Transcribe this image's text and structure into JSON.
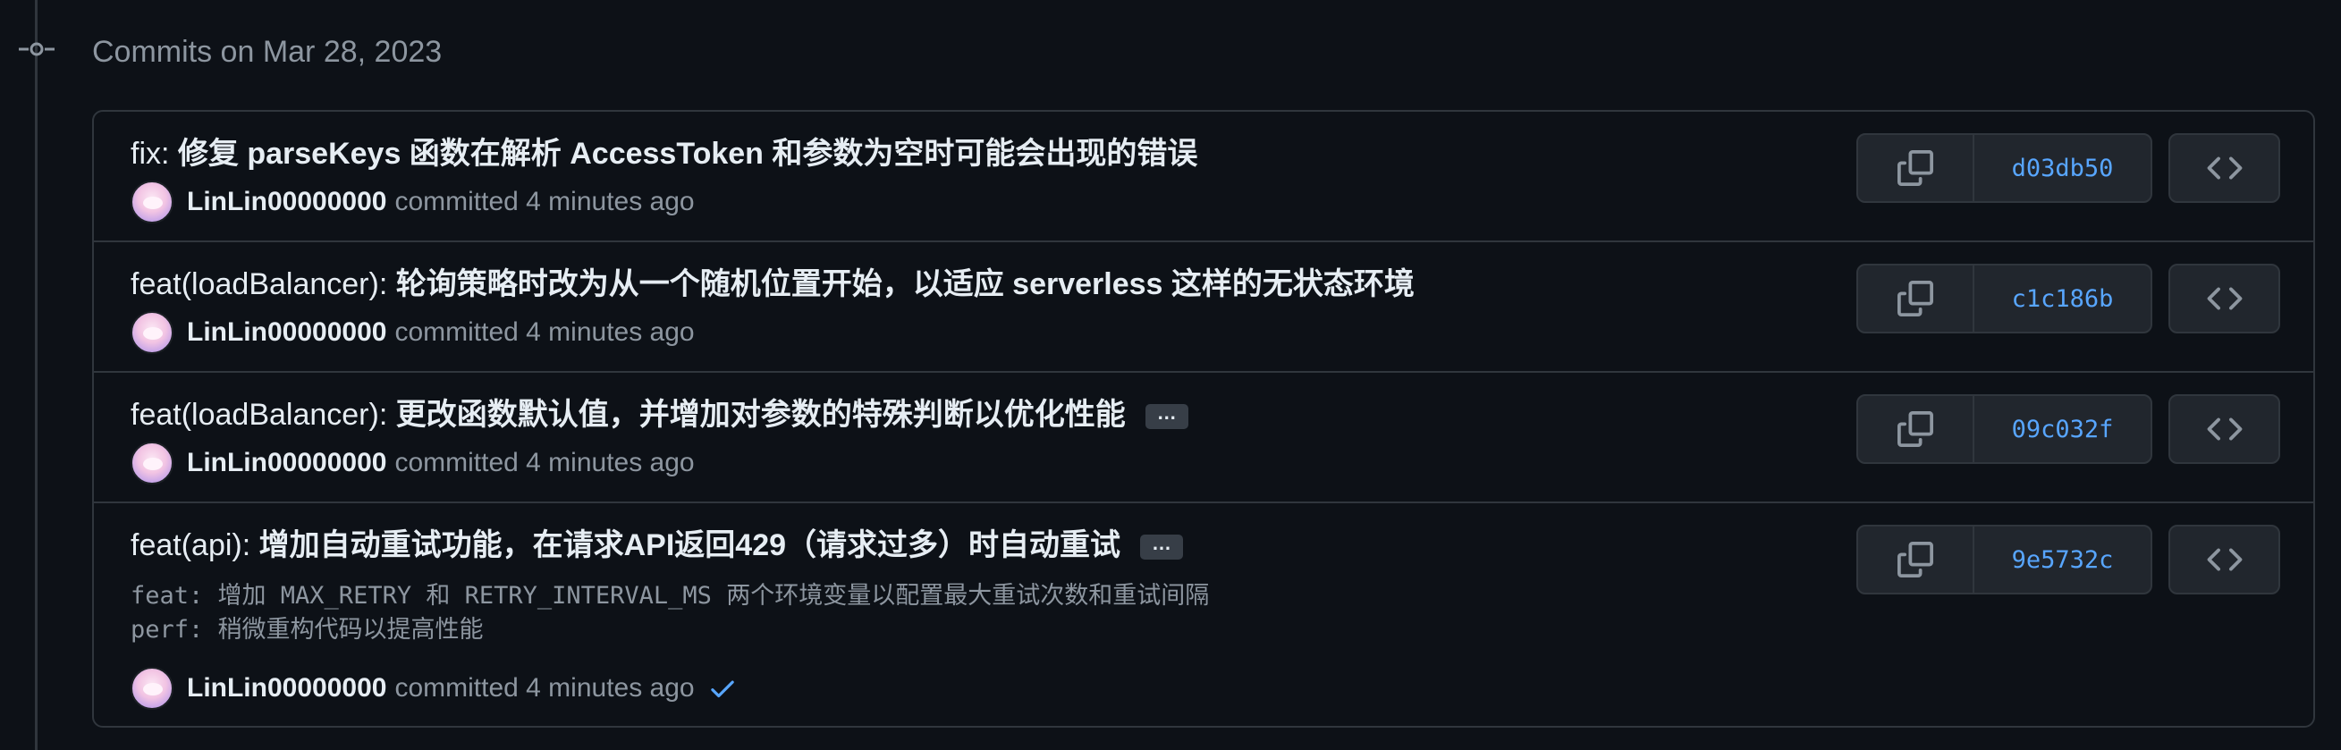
{
  "group": {
    "header": "Commits on Mar 28, 2023"
  },
  "commits": [
    {
      "title_prefix": "fix:",
      "title_rest": " 修复 parseKeys 函数在解析 AccessToken 和参数为空时可能会出现的错误",
      "author": "LinLin00000000",
      "time": "committed 4 minutes ago",
      "sha": "d03db50"
    },
    {
      "title_prefix": "feat(loadBalancer):",
      "title_rest": " 轮询策略时改为从一个随机位置开始，以适应 serverless 这样的无状态环境",
      "author": "LinLin00000000",
      "time": "committed 4 minutes ago",
      "sha": "c1c186b"
    },
    {
      "title_prefix": "feat(loadBalancer):",
      "title_rest": " 更改函数默认值，并增加对参数的特殊判断以优化性能",
      "ellipsis": "…",
      "author": "LinLin00000000",
      "time": "committed 4 minutes ago",
      "sha": "09c032f"
    },
    {
      "title_prefix": "feat(api):",
      "title_rest": " 增加自动重试功能，在请求API返回429（请求过多）时自动重试",
      "ellipsis": "…",
      "body_line1": "feat: 增加 MAX_RETRY 和 RETRY_INTERVAL_MS 两个环境变量以配置最大重试次数和重试间隔",
      "body_line2": "perf: 稍微重构代码以提高性能",
      "author": "LinLin00000000",
      "time": "committed 4 minutes ago",
      "sha": "9e5732c",
      "status_icon": "check-icon"
    }
  ],
  "colors": {
    "background": "#0d1117",
    "border": "#30363d",
    "muted_text": "#8d96a0",
    "sha_link": "#58a6ff",
    "check": "#58a6ff"
  },
  "icons": [
    "git-commit-icon",
    "avatar",
    "copy-icon",
    "code-icon",
    "check-icon"
  ]
}
